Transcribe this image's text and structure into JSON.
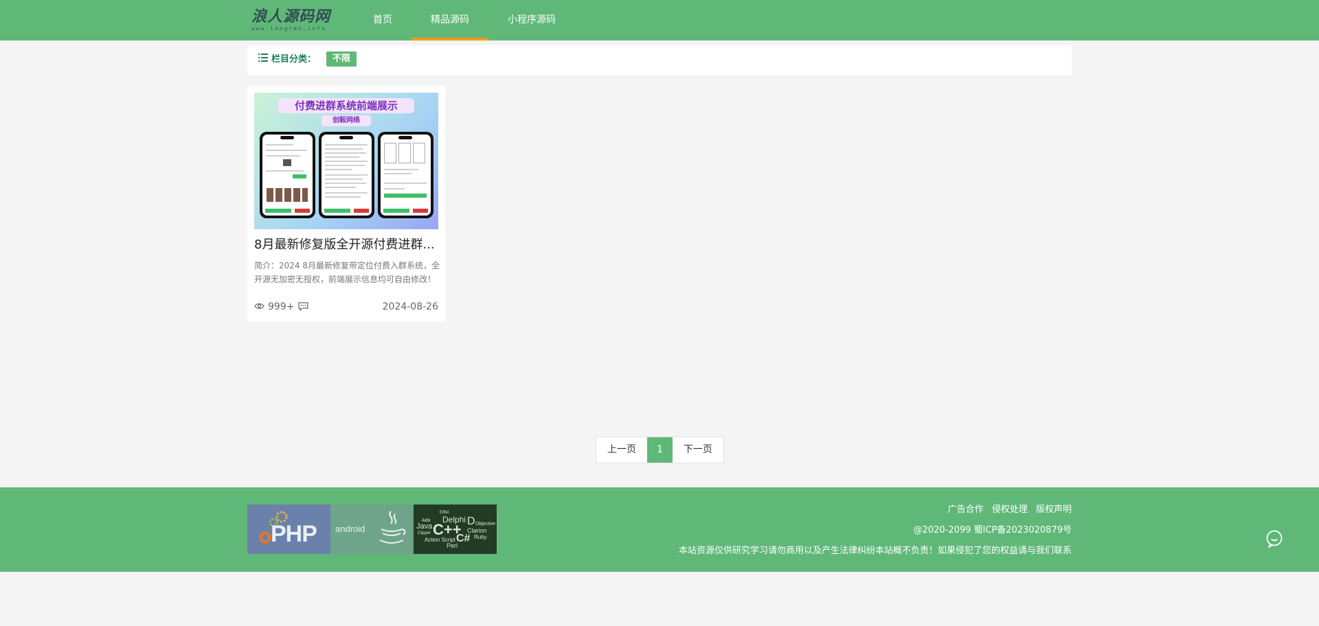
{
  "header": {
    "logo_text": "浪人源码网",
    "logo_sub": "www.langren.info",
    "nav": [
      {
        "label": "首页",
        "active": false
      },
      {
        "label": "精品源码",
        "active": true
      },
      {
        "label": "小程序源码",
        "active": false
      }
    ]
  },
  "category": {
    "label": "栏目分类：",
    "tag": "不限"
  },
  "card": {
    "thumb_title": "付费进群系统前端展示",
    "thumb_sub": "创毅网络",
    "title": "8月最新修复版全开源付费进群...",
    "desc": "简介：2024 8月最新修复带定位付费入群系统，全开源无加密无授权，前端展示信息均可自由修改！",
    "views": "999+",
    "date": "2024-08-26"
  },
  "pagination": {
    "prev": "上一页",
    "current": "1",
    "next": "下一页"
  },
  "footer": {
    "images": {
      "php": "PHP",
      "android": "android",
      "langs": [
        "Delphi",
        "Java",
        "Ada",
        "C++",
        "C#",
        "Clarion",
        "Objective",
        "Ruby",
        "Perl",
        "Action Script",
        "Clipper",
        "D",
        "Eiffel"
      ]
    },
    "links": [
      "广告合作",
      "侵权处理",
      "版权声明"
    ],
    "copyright": "@2020-2099 蜀ICP备2023020879号",
    "disclaimer": "本站资源仅供研究学习请勿商用以及产生法律纠纷本站概不负责！如果侵犯了您的权益请与我们联系"
  },
  "colors": {
    "brand_green": "#5fb878",
    "nav_active_underline": "#f39c12",
    "category_text": "#1a7a5e"
  },
  "icons": [
    "list-icon",
    "eye-icon",
    "comment-icon",
    "chat-bubble-icon"
  ]
}
